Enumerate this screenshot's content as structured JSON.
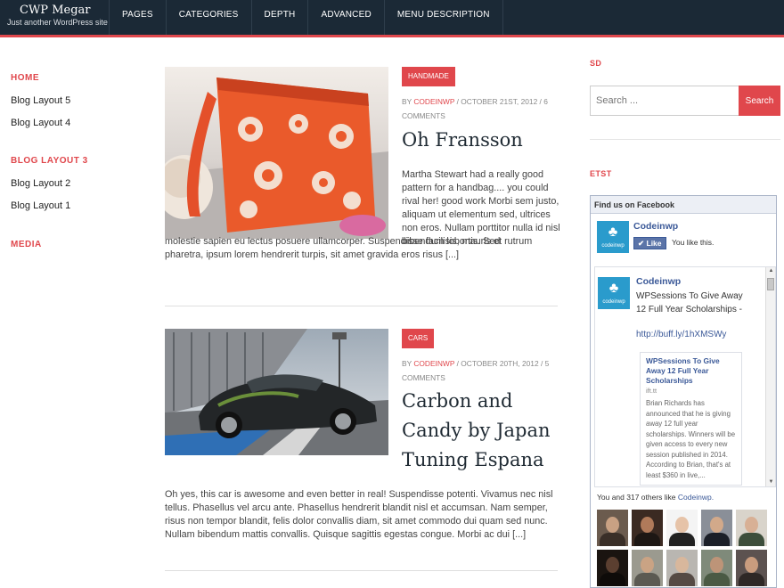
{
  "site": {
    "title": "CWP Megar",
    "tagline": "Just another WordPress site"
  },
  "nav": [
    "PAGES",
    "CATEGORIES",
    "DEPTH",
    "ADVANCED",
    "MENU DESCRIPTION"
  ],
  "left_menu": {
    "home": "HOME",
    "blog_layout_5": "Blog Layout 5",
    "blog_layout_4": "Blog Layout 4",
    "blog_layout_3": "BLOG LAYOUT 3",
    "blog_layout_2": "Blog Layout 2",
    "blog_layout_1": "Blog Layout 1",
    "media": "MEDIA"
  },
  "posts": [
    {
      "badge": "HANDMADE",
      "meta_by": "BY ",
      "author": "CODEINWP",
      "meta_rest": " / OCTOBER 21ST, 2012 / 6 COMMENTS",
      "title": "Oh Fransson",
      "excerpt_side": "Martha Stewart had a really good pattern for a handbag.... you could rival her! good work Morbi sem justo, aliquam ut elementum sed, ultrices non eros. Nullam porttitor nulla id nisl bibendum lobortis. Sed",
      "excerpt_full": "molestie sapien eu lectus posuere ullamcorper. Suspendisse facilisis, mauris et rutrum pharetra, ipsum lorem hendrerit turpis, sit amet gravida eros risus [...]",
      "image": "handbag-photo"
    },
    {
      "badge": "CARS",
      "meta_by": "BY ",
      "author": "CODEINWP",
      "meta_rest": " / OCTOBER 20TH, 2012 / 5 COMMENTS",
      "title": "Carbon and Candy by Japan Tuning Espana",
      "excerpt_full": "Oh yes, this car is awesome and even better in real! Suspendisse potenti. Vivamus nec nisl tellus. Phasellus vel arcu ante. Phasellus hendrerit blandit nisl et accumsan. Nam semper, risus non tempor blandit, felis dolor convallis diam, sit amet commodo dui quam sed nunc. Nullam bibendum mattis convallis. Quisque sagittis egestas congue. Morbi ac dui [...]",
      "image": "sports-car-photo"
    }
  ],
  "sidebar": {
    "widget1_title": "SD",
    "search_placeholder": "Search ...",
    "search_button": "Search",
    "widget2_title": "ETST"
  },
  "facebook": {
    "header": "Find us on Facebook",
    "page_name": "Codeinwp",
    "logo_text": "codeinwp",
    "like_button": "Like",
    "like_text": "You like this.",
    "feed_name": "Codeinwp",
    "feed_text": "WPSessions To Give Away 12 Full Year Scholarships -",
    "feed_link": "http://buff.ly/1hXMSWy",
    "card_title": "WPSessions To Give Away 12 Full Year Scholarships",
    "card_source": "ift.tt",
    "card_body": "Brian Richards has announced that he is giving away 12 full year scholarships. Winners will be given access to every new session published in 2014. According to Brian, that's at least $360 in live,...",
    "others_prefix": "You and 317 others like ",
    "others_link": "Codeinwp.",
    "others_suffix": "",
    "faces": [
      {
        "bg": "#6b5b4e",
        "skin": "#c9a183",
        "shirt": "#3a2f28"
      },
      {
        "bg": "#3b2a22",
        "skin": "#b07a5a",
        "shirt": "#1d1714"
      },
      {
        "bg": "#f4f4f4",
        "skin": "#e6c3a8",
        "shirt": "#222222"
      },
      {
        "bg": "#8a8f98",
        "skin": "#d2a98a",
        "shirt": "#1b1f28"
      },
      {
        "bg": "#d9d4cb",
        "skin": "#d8b095",
        "shirt": "#3d4e3b"
      },
      {
        "bg": "#1a1410",
        "skin": "#5b3f30",
        "shirt": "#0e0b09"
      },
      {
        "bg": "#9b9a8f",
        "skin": "#caa384",
        "shirt": "#5b5a52"
      },
      {
        "bg": "#b9b6b1",
        "skin": "#d8b79c",
        "shirt": "#554a44"
      },
      {
        "bg": "#7f8a7a",
        "skin": "#bd9478",
        "shirt": "#4a5a44"
      },
      {
        "bg": "#5c5250",
        "skin": "#c99c7e",
        "shirt": "#2e2826"
      }
    ]
  }
}
